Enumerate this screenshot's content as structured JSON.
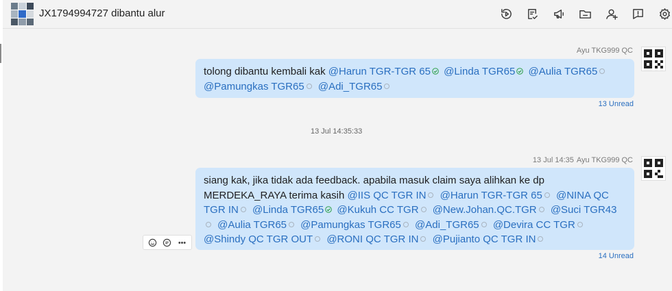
{
  "header": {
    "title": "JX1794994727 dibantu alur",
    "toolbar_icons": [
      "history-icon",
      "task-icon",
      "announcement-icon",
      "folder-icon",
      "add-member-icon",
      "feedback-icon",
      "settings-icon"
    ]
  },
  "messages": [
    {
      "sender": "Ayu TKG999 QC",
      "time": "",
      "unread": "13 Unread",
      "segments": [
        {
          "t": "text",
          "v": "tolong dibantu kembali kak "
        },
        {
          "t": "mention",
          "v": "@Harun TGR-TGR 65",
          "read": true
        },
        {
          "t": "mention",
          "v": "@Linda TGR65",
          "read": true
        },
        {
          "t": "mention",
          "v": "@Aulia TGR65",
          "read": false
        },
        {
          "t": "mention",
          "v": "@Pamungkas TGR65",
          "read": false
        },
        {
          "t": "mention",
          "v": "@Adi_TGR65",
          "read": false
        }
      ]
    },
    {
      "sender": "Ayu TKG999 QC",
      "time": "13 Jul 14:35",
      "unread": "14 Unread",
      "segments": [
        {
          "t": "text",
          "v": "siang kak, jika tidak ada feedback. apabila masuk claim saya alihkan ke dp MERDEKA_RAYA terima kasih "
        },
        {
          "t": "mention",
          "v": "@IIS QC TGR IN",
          "read": false
        },
        {
          "t": "mention",
          "v": "@Harun TGR-TGR 65",
          "read": false
        },
        {
          "t": "mention",
          "v": "@NINA QC TGR IN",
          "read": false
        },
        {
          "t": "mention",
          "v": "@Linda TGR65",
          "read": true
        },
        {
          "t": "mention",
          "v": "@Kukuh CC TGR",
          "read": false
        },
        {
          "t": "mention",
          "v": "@New.Johan.QC.TGR",
          "read": false
        },
        {
          "t": "mention",
          "v": "@Suci TGR43",
          "read": false
        },
        {
          "t": "mention",
          "v": "@Aulia TGR65",
          "read": false
        },
        {
          "t": "mention",
          "v": "@Pamungkas TGR65",
          "read": false
        },
        {
          "t": "mention",
          "v": "@Adi_TGR65",
          "read": false
        },
        {
          "t": "mention",
          "v": "@Devira CC TGR",
          "read": false
        },
        {
          "t": "mention",
          "v": "@Shindy QC TGR OUT",
          "read": false
        },
        {
          "t": "mention",
          "v": "@RONI QC TGR IN",
          "read": false
        },
        {
          "t": "mention",
          "v": "@Pujianto QC TGR IN",
          "read": false
        }
      ]
    }
  ],
  "divider_time": "13 Jul 14:35:33",
  "message_actions": [
    "emoji-reaction-icon",
    "reply-icon",
    "more-icon"
  ],
  "colors": {
    "bubble": "#d0e6fb",
    "mention": "#2a6fc0",
    "read_check": "#2fa04a",
    "background": "#f3f3f3"
  }
}
